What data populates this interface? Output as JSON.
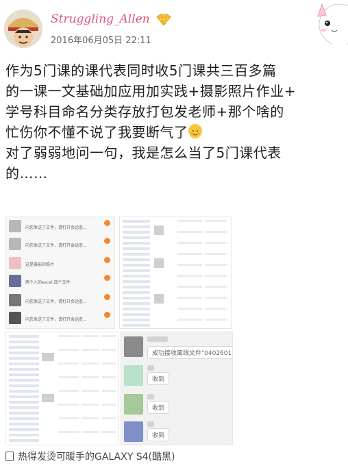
{
  "post": {
    "username": "Struggling_Allen",
    "timestamp": "2016年06月05日 22:11",
    "lines": [
      "作为5门课的课代表同时收5门课共三百多篇",
      "的一课一文基础加应用加实践+摄影照片作业+",
      "学号科目命名分类存放打包发老师+那个啥的",
      "忙伤你不懂不说了我要断气了",
      "对了弱弱地问一句，我是怎么当了5门课代表",
      "的……"
    ],
    "source": "热得发烫可暖手的GALAXY S4(酷黑)"
  },
  "icons": {
    "vip": "vip-diamond-icon",
    "emoji": "blush-emoji-icon",
    "phone": "phone-icon"
  },
  "colors": {
    "username": "#e0557a",
    "badge": "#f08a2c"
  },
  "screenshot1": {
    "chats": [
      {
        "text": "向您发送了文件，请打开会话查..."
      },
      {
        "text": "向您发送了文件，请打开会话查..."
      },
      {
        "text": "这是摄影的照片"
      },
      {
        "text": "两个人的excel 四个文件"
      },
      {
        "text": "向您发送了文件，请打开会话查..."
      },
      {
        "text": "向您发送了文件，请打开会话查..."
      }
    ]
  },
  "screenshot4": {
    "messages": [
      {
        "text": "成功接收离线文件\"0402601"
      },
      {
        "text": "收到"
      },
      {
        "text": "收到"
      },
      {
        "text": "收到"
      }
    ]
  }
}
